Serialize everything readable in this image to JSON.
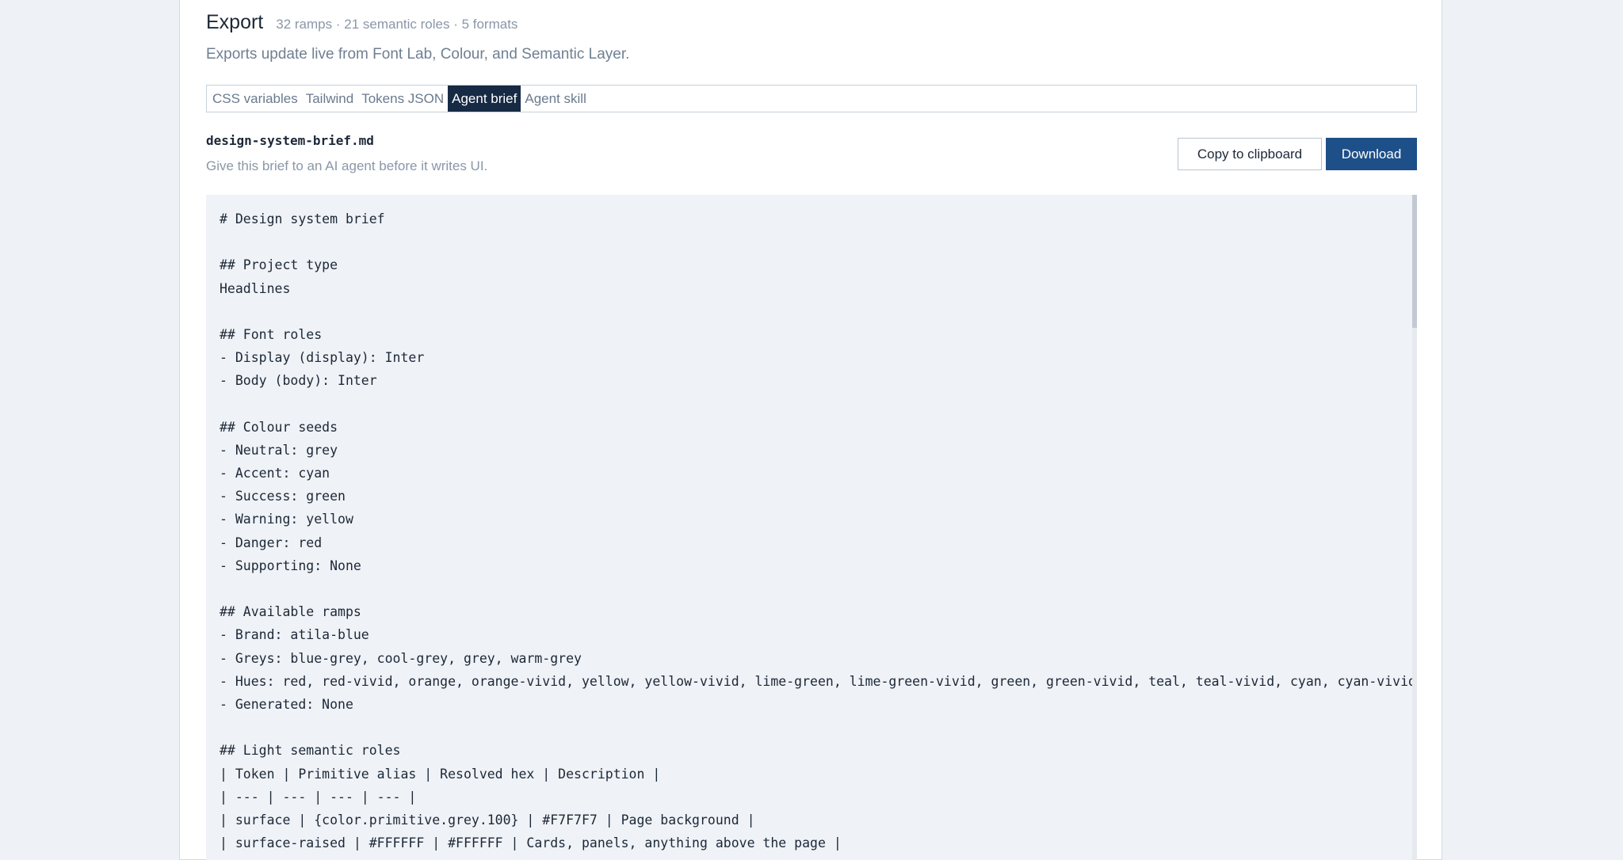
{
  "export": {
    "title": "Export",
    "meta": "32 ramps · 21 semantic roles · 5 formats",
    "subtitle": "Exports update live from Font Lab, Colour, and Semantic Layer."
  },
  "tabs": [
    {
      "label": "CSS variables",
      "active": false
    },
    {
      "label": "Tailwind",
      "active": false
    },
    {
      "label": "Tokens JSON",
      "active": false
    },
    {
      "label": "Agent brief",
      "active": true
    },
    {
      "label": "Agent skill",
      "active": false
    }
  ],
  "file": {
    "name": "design-system-brief.md",
    "hint": "Give this brief to an AI agent before it writes UI."
  },
  "actions": {
    "copy_label": "Copy to clipboard",
    "download_label": "Download"
  },
  "code_lines": [
    "# Design system brief",
    "",
    "## Project type",
    "Headlines",
    "",
    "## Font roles",
    "- Display (display): Inter",
    "- Body (body): Inter",
    "",
    "## Colour seeds",
    "- Neutral: grey",
    "- Accent: cyan",
    "- Success: green",
    "- Warning: yellow",
    "- Danger: red",
    "- Supporting: None",
    "",
    "## Available ramps",
    "- Brand: atila-blue",
    "- Greys: blue-grey, cool-grey, grey, warm-grey",
    "- Hues: red, red-vivid, orange, orange-vivid, yellow, yellow-vivid, lime-green, lime-green-vivid, green, green-vivid, teal, teal-vivid, cyan, cyan-vivid",
    "- Generated: None",
    "",
    "## Light semantic roles",
    "| Token | Primitive alias | Resolved hex | Description |",
    "| --- | --- | --- | --- |",
    "| surface | {color.primitive.grey.100} | #F7F7F7 | Page background |",
    "| surface-raised | #FFFFFF | #FFFFFF | Cards, panels, anything above the page |"
  ]
}
